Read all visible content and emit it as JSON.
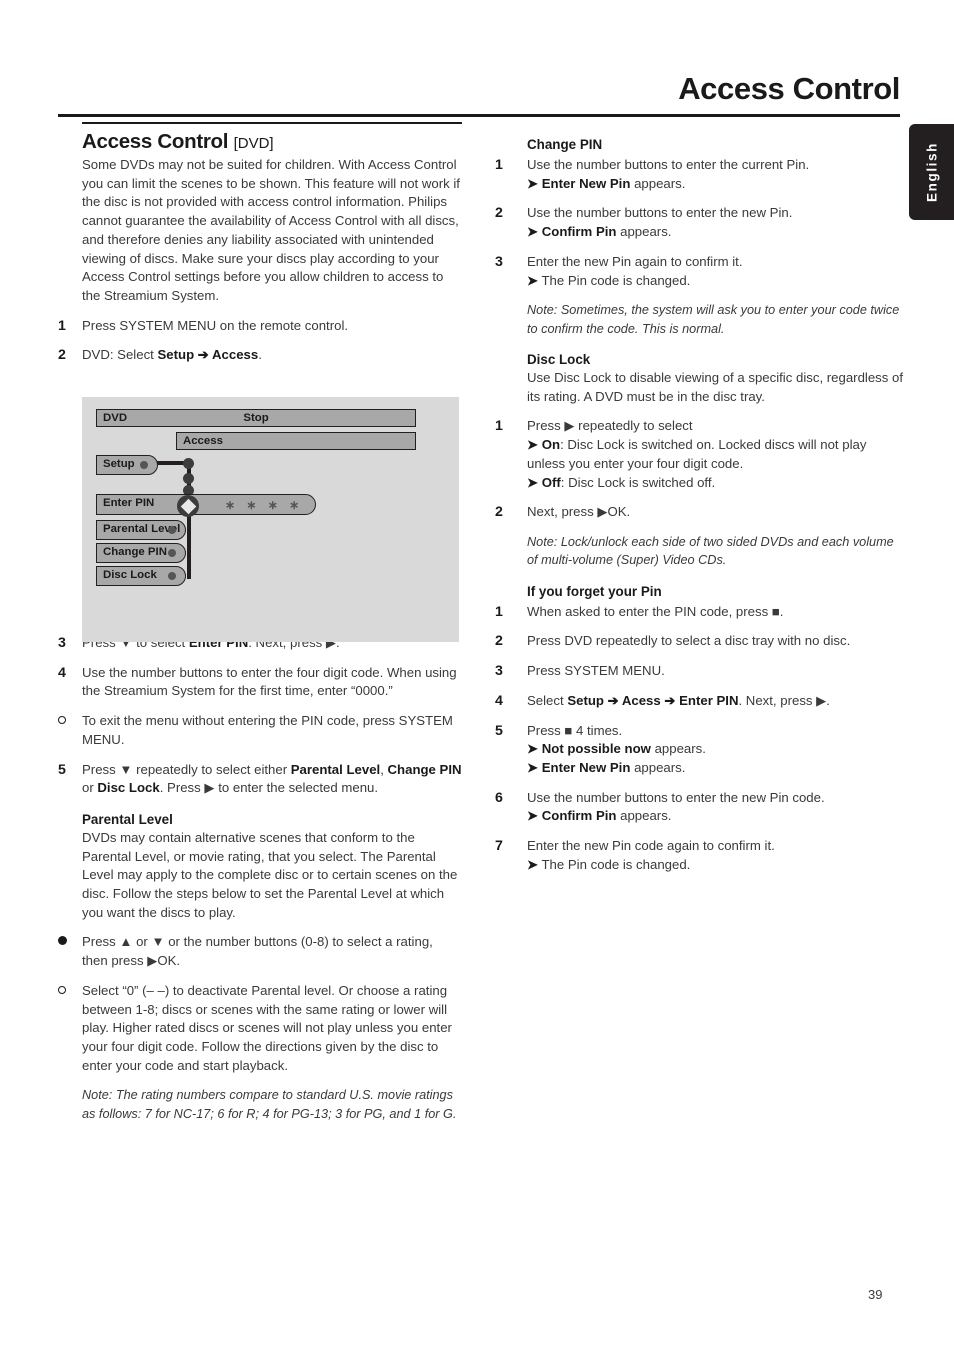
{
  "header": {
    "title": "Access Control"
  },
  "side_tab": {
    "label": "English"
  },
  "page_number": "39",
  "left_column": {
    "section_title": "Access Control",
    "section_tagline": "[DVD]",
    "intro": "Some DVDs may not be suited for children. With Access Control you can limit the scenes to be shown. This feature will not work if the disc is not provided with access control information. Philips cannot guarantee the availability of Access Control with all discs, and therefore denies any liability associated with unintended viewing of discs. Make sure your discs play according to your Access Control settings before you allow children to access to the Streamium System.",
    "step1_marker": "1",
    "step1_text": "Press SYSTEM MENU on the remote control.",
    "step2_marker": "2",
    "step2_pre": "DVD: Select ",
    "step2_b1": "Setup",
    "step2_mid": " ➔ ",
    "step2_b2": "Access",
    "step2_post": ".",
    "step3_marker": "3",
    "step3_pre": "Press ▼ to select ",
    "step3_b1": "Enter PIN",
    "step3_post": ". Next, press ▶.",
    "step4_marker": "4",
    "step4_text": "Use the number buttons to enter the four digit code. When using the Streamium System for the first time, enter “0000.”",
    "bullet1_text": "To exit the menu without entering the PIN code, press SYSTEM MENU.",
    "step5_marker": "5",
    "step5_pre": "Press ▼ repeatedly to select either ",
    "step5_b1": "Parental Level",
    "step5_mid1": ", ",
    "step5_b2": "Change PIN",
    "step5_mid2": " or ",
    "step5_b3": "Disc Lock",
    "step5_post": ". Press ▶ to enter the selected menu.",
    "parental_head": "Parental Level",
    "parental_body": "DVDs may contain alternative scenes that conform to the Parental Level, or movie rating, that you select. The Parental Level may apply to the complete disc or to certain scenes on the disc. Follow the steps below to set the Parental Level at which you want the discs to play.",
    "bullet2_text": "Press ▲ or ▼ or the number buttons (0-8) to select a rating, then press ▶OK.",
    "bullet3_text": "Select “0” (– –) to deactivate Parental level. Or choose a rating between 1-8; discs or scenes with the same rating or lower will play. Higher rated discs or scenes will not play unless you enter your four digit code. Follow the directions given by the disc to enter your code and start playback.",
    "note1": "Note: The rating numbers compare to standard U.S. movie ratings as follows: 7 for NC-17; 6 for R; 4 for PG-13; 3 for PG, and 1 for G."
  },
  "osd": {
    "row_dvd": "DVD",
    "row_status": "Stop",
    "row_access": "Access",
    "item_setup": "Setup",
    "item_enter_pin": "Enter PIN",
    "pin_value": "∗ ∗ ∗ ∗",
    "item_parental_level": "Parental Level",
    "item_change_pin": "Change PIN",
    "item_disc_lock": "Disc Lock"
  },
  "right_column": {
    "changepin_head": "Change PIN",
    "cp1_marker": "1",
    "cp1_text": "Use the number buttons to enter the current Pin.",
    "cp1_arrow_b": "Enter New Pin",
    "cp1_arrow_rest": " appears.",
    "cp2_marker": "2",
    "cp2_text": "Use the number buttons to enter the new Pin.",
    "cp2_arrow_b": "Confirm Pin",
    "cp2_arrow_rest": " appears.",
    "cp3_marker": "3",
    "cp3_text": "Enter the new Pin again to confirm it.",
    "cp3_arrow_rest": "The Pin code is changed.",
    "cp_note": "Note: Sometimes, the system will ask you to enter your code twice to confirm the code. This is normal.",
    "disclock_head": "Disc Lock",
    "disclock_body": "Use Disc Lock to disable viewing of a specific disc, regardless of its rating. A DVD must be in the disc tray.",
    "dl1_marker": "1",
    "dl1_text": "Press ▶ repeatedly to select",
    "dl1_on_b": "On",
    "dl1_on_rest": ": Disc Lock is switched on. Locked discs will not play unless you enter your four digit code.",
    "dl1_off_b": "Off",
    "dl1_off_rest": ": Disc Lock is switched off.",
    "dl2_marker": "2",
    "dl2_text": "Next, press ▶OK.",
    "dl_note": "Note: Lock/unlock each side of two sided DVDs and each volume of multi-volume (Super) Video CDs.",
    "forgot_head": "If you forget your Pin",
    "fg1_marker": "1",
    "fg1_text": "When asked to enter the PIN code, press ■.",
    "fg2_marker": "2",
    "fg2_text": "Press DVD repeatedly to select a disc tray with no disc.",
    "fg3_marker": "3",
    "fg3_text": "Press SYSTEM MENU.",
    "fg4_marker": "4",
    "fg4_pre": "Select ",
    "fg4_b1": "Setup",
    "fg4_m1": " ➔ ",
    "fg4_b2": "Acess",
    "fg4_m2": " ➔ ",
    "fg4_b3": "Enter PIN",
    "fg4_post": ". Next, press ▶.",
    "fg5_marker": "5",
    "fg5_text": "Press ■ 4 times.",
    "fg5_a1_b": "Not possible now",
    "fg5_a1_rest": " appears.",
    "fg5_a2_b": "Enter New Pin",
    "fg5_a2_rest": " appears.",
    "fg6_marker": "6",
    "fg6_text": "Use the number buttons to enter the new Pin code.",
    "fg6_arrow_b": "Confirm Pin",
    "fg6_arrow_rest": " appears.",
    "fg7_marker": "7",
    "fg7_text": "Enter the new Pin code again to confirm it.",
    "fg7_arrow_rest": "The Pin code is changed."
  }
}
